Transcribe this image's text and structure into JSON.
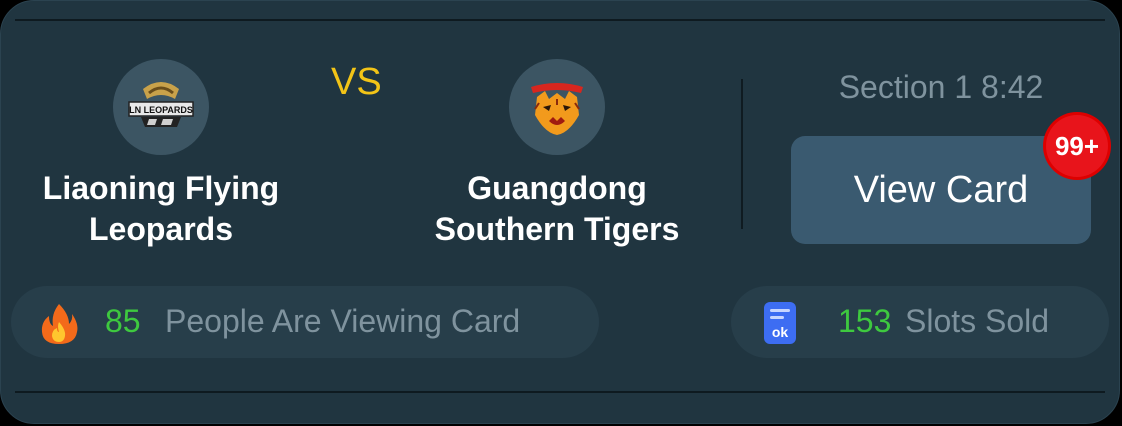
{
  "match": {
    "home_team": {
      "name_line1": "Liaoning Flying",
      "name_line2": "Leopards",
      "logo": "leopards-logo-icon",
      "logo_text": "LN LEOPARDS"
    },
    "vs_label": "VS",
    "away_team": {
      "name_line1": "Guangdong",
      "name_line2": "Southern Tigers",
      "logo": "tigers-logo-icon"
    }
  },
  "status": {
    "section_time": "Section 1 8:42"
  },
  "actions": {
    "view_card_label": "View Card",
    "badge_count": "99+"
  },
  "stats": {
    "viewers_count": "85",
    "viewers_text": "People Are Viewing Card",
    "viewers_icon": "fire-icon",
    "slots_count": "153",
    "slots_text": "Slots Sold",
    "slots_icon": "ticket-icon"
  },
  "colors": {
    "card_bg": "#203540",
    "vs_color": "#f2c417",
    "accent_green": "#3ec93f",
    "muted_text": "#7f939e",
    "button_bg": "#3a5a70",
    "badge_bg": "#e8141b"
  }
}
